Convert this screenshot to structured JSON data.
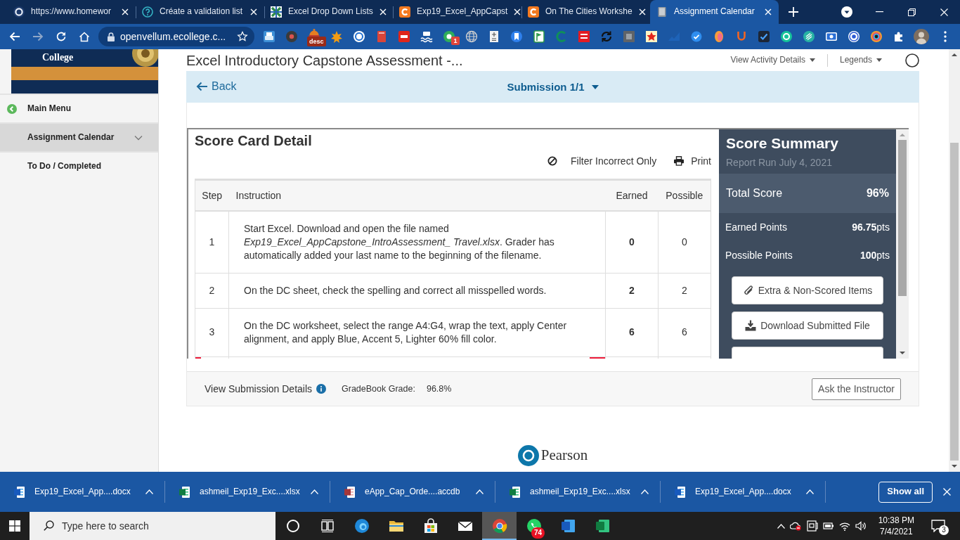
{
  "browser": {
    "tabs": [
      {
        "title": "https://www.homewor",
        "kind": "ring",
        "selected": false
      },
      {
        "title": "Créate a validation list",
        "kind": "question",
        "selected": false
      },
      {
        "title": "Excel Drop Down Lists",
        "kind": "grid",
        "selected": false
      },
      {
        "title": "Exp19_Excel_AppCapst",
        "kind": "tile",
        "selected": false
      },
      {
        "title": "On The Cities Workshe",
        "kind": "tile",
        "selected": false
      },
      {
        "title": "Assignment Calendar",
        "kind": "book",
        "selected": true
      }
    ],
    "address": "openvellum.ecollege.c...",
    "extensions": [
      {
        "kind": "printer"
      },
      {
        "kind": "disc"
      },
      {
        "kind": "bell",
        "badge": "desc"
      },
      {
        "kind": "splash"
      },
      {
        "kind": "at"
      },
      {
        "kind": "book"
      },
      {
        "kind": "pdf"
      },
      {
        "kind": "wave"
      },
      {
        "kind": "dot",
        "badge": "1"
      },
      {
        "kind": "globe"
      },
      {
        "kind": "sheet"
      },
      {
        "kind": "bookmark"
      },
      {
        "kind": "flag"
      },
      {
        "kind": "crescent"
      },
      {
        "kind": "block"
      },
      {
        "kind": "cycle"
      },
      {
        "kind": "slate"
      },
      {
        "kind": "star"
      },
      {
        "kind": "trend"
      },
      {
        "kind": "check"
      },
      {
        "kind": "balloon"
      },
      {
        "kind": "horseshoe"
      },
      {
        "kind": "checkbox"
      },
      {
        "kind": "mint"
      },
      {
        "kind": "stripes"
      },
      {
        "kind": "screen"
      },
      {
        "kind": "target"
      },
      {
        "kind": "lens"
      }
    ]
  },
  "sidebar": {
    "logo_text": "College",
    "items": [
      {
        "label": "Main Menu",
        "kind": "back",
        "selected": false
      },
      {
        "label": "Assignment Calendar",
        "kind": "expandable",
        "selected": true
      },
      {
        "label": "To Do / Completed",
        "kind": "link",
        "selected": false
      }
    ]
  },
  "header": {
    "title": "Excel Introductory Capstone Assessment -...",
    "links": [
      "View Activity Details",
      "Legends"
    ]
  },
  "submission_bar": {
    "back": "Back",
    "title": "Submission 1/1"
  },
  "score_card": {
    "title": "Score Card Detail",
    "tools": [
      {
        "label": "Filter Incorrect Only",
        "kind": "filter"
      },
      {
        "label": "Print",
        "kind": "print"
      }
    ],
    "table": {
      "columns": [
        "Step",
        "Instruction",
        "Earned",
        "Possible"
      ],
      "rows": [
        {
          "step": "1",
          "instruction": "Start Excel. Download and open the file named *Exp19_Excel_AppCapstone_IntroAssessment_ Travel.xlsx*. Grader has automatically added your last name to the beginning of the filename.",
          "earned": "0",
          "possible": "0",
          "flagged": false
        },
        {
          "step": "2",
          "instruction": "On the DC sheet, check the spelling and correct all misspelled words.",
          "earned": "2",
          "possible": "2",
          "flagged": false
        },
        {
          "step": "3",
          "instruction": "On the DC worksheet, select the range A4:G4, wrap the text, apply Center alignment, and apply Blue, Accent 5, Lighter 60% fill color.",
          "earned": "6",
          "possible": "6",
          "flagged": false
        },
        {
          "flagged": true
        }
      ]
    }
  },
  "score_summary": {
    "title": "Score Summary",
    "report_run": "Report Run July 4, 2021",
    "total_label": "Total Score",
    "total_value": "96%",
    "stats": [
      {
        "label": "Earned Points",
        "value": "**96.75**pts"
      },
      {
        "label": "Possible Points",
        "value": "**100**pts"
      }
    ],
    "buttons": [
      {
        "label": "Extra & Non-Scored Items",
        "kind": "paperclip"
      },
      {
        "label": "Download Submitted File",
        "kind": "download"
      },
      {
        "kind": "partial"
      }
    ]
  },
  "footer": {
    "details_link": "View Submission Details",
    "grade_label": "GradeBook Grade:",
    "grade": "96.8%",
    "ask_button": "Ask the Instructor"
  },
  "brand": "Pearson",
  "downloads": {
    "items": [
      {
        "name": "Exp19_Excel_App....docx",
        "kind": "document"
      },
      {
        "name": "ashmeil_Exp19_Exc....xlsx",
        "kind": "spreadsheet"
      },
      {
        "name": "eApp_Cap_Orde....accdb",
        "kind": "database"
      },
      {
        "name": "ashmeil_Exp19_Exc....xlsx",
        "kind": "spreadsheet"
      },
      {
        "name": "Exp19_Excel_App....docx",
        "kind": "document"
      }
    ],
    "show_all": "Show all"
  },
  "taskbar": {
    "search_placeholder": "Type here to search",
    "apps": [
      {
        "kind": "ring",
        "selected": false
      },
      {
        "kind": "taskview",
        "selected": false
      },
      {
        "kind": "swirl",
        "selected": false
      },
      {
        "kind": "folder",
        "selected": false
      },
      {
        "kind": "bag",
        "selected": false
      },
      {
        "kind": "mail",
        "selected": false
      },
      {
        "kind": "browser",
        "selected": true
      },
      {
        "kind": "chat",
        "badge": "74",
        "selected": false
      },
      {
        "kind": "document",
        "selected": false
      },
      {
        "kind": "spreadsheet",
        "selected": false
      }
    ],
    "time": "10:38 PM",
    "date": "7/4/2021",
    "notification_count": "3"
  }
}
